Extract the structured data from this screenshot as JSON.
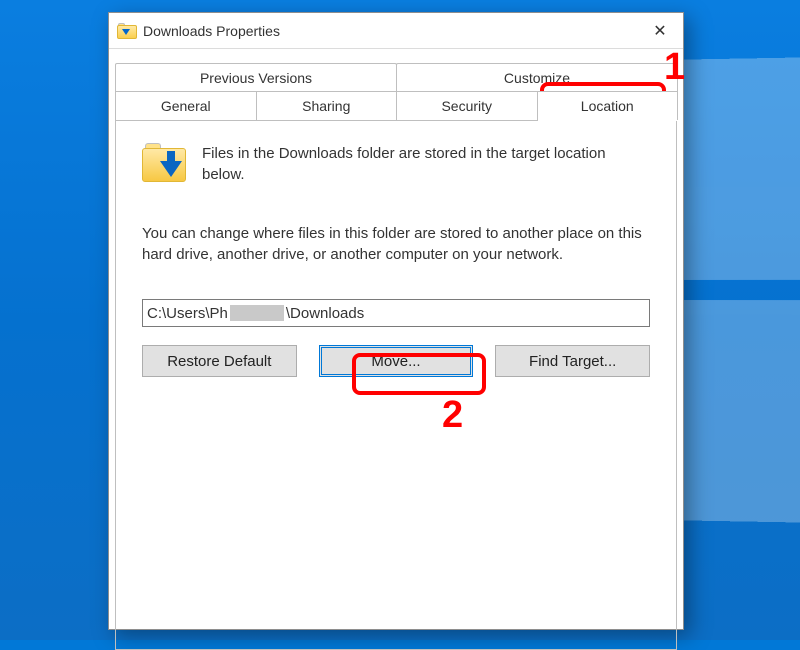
{
  "window": {
    "title": "Downloads Properties"
  },
  "tabs": {
    "row1": [
      "Previous Versions",
      "Customize"
    ],
    "row2": [
      "General",
      "Sharing",
      "Security",
      "Location"
    ],
    "active": "Location"
  },
  "content": {
    "desc1": "Files in the Downloads folder are stored in the target location below.",
    "desc2": "You can change where files in this folder are stored to another place on this hard drive, another drive, or another computer on your network.",
    "path_prefix": "C:\\Users\\Ph",
    "path_suffix": "\\Downloads"
  },
  "buttons": {
    "restore": "Restore Default",
    "move": "Move...",
    "find": "Find Target..."
  },
  "annotations": {
    "n1": "1",
    "n2": "2"
  }
}
